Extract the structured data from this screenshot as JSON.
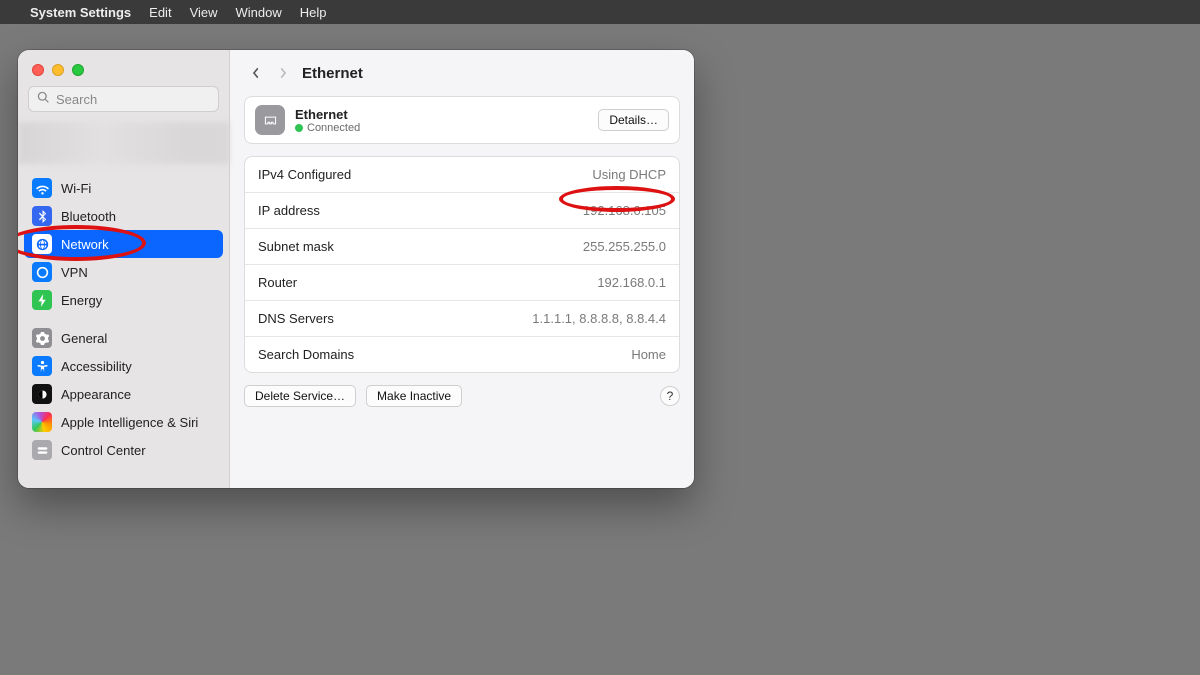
{
  "menubar": {
    "app": "System Settings",
    "items": [
      "Edit",
      "View",
      "Window",
      "Help"
    ]
  },
  "search": {
    "placeholder": "Search"
  },
  "sidebar": {
    "group1": [
      {
        "label": "Wi-Fi"
      },
      {
        "label": "Bluetooth"
      },
      {
        "label": "Network"
      },
      {
        "label": "VPN"
      },
      {
        "label": "Energy"
      }
    ],
    "group2": [
      {
        "label": "General"
      },
      {
        "label": "Accessibility"
      },
      {
        "label": "Appearance"
      },
      {
        "label": "Apple Intelligence & Siri"
      },
      {
        "label": "Control Center"
      }
    ]
  },
  "header": {
    "title": "Ethernet"
  },
  "connection": {
    "name": "Ethernet",
    "status": "Connected",
    "details_btn": "Details…"
  },
  "rows": [
    {
      "label": "IPv4 Configured",
      "value": "Using DHCP"
    },
    {
      "label": "IP address",
      "value": "192.168.0.105"
    },
    {
      "label": "Subnet mask",
      "value": "255.255.255.0"
    },
    {
      "label": "Router",
      "value": "192.168.0.1"
    },
    {
      "label": "DNS Servers",
      "value": "1.1.1.1, 8.8.8.8, 8.8.4.4"
    },
    {
      "label": "Search Domains",
      "value": "Home"
    }
  ],
  "actions": {
    "delete": "Delete Service…",
    "inactive": "Make Inactive",
    "help": "?"
  }
}
